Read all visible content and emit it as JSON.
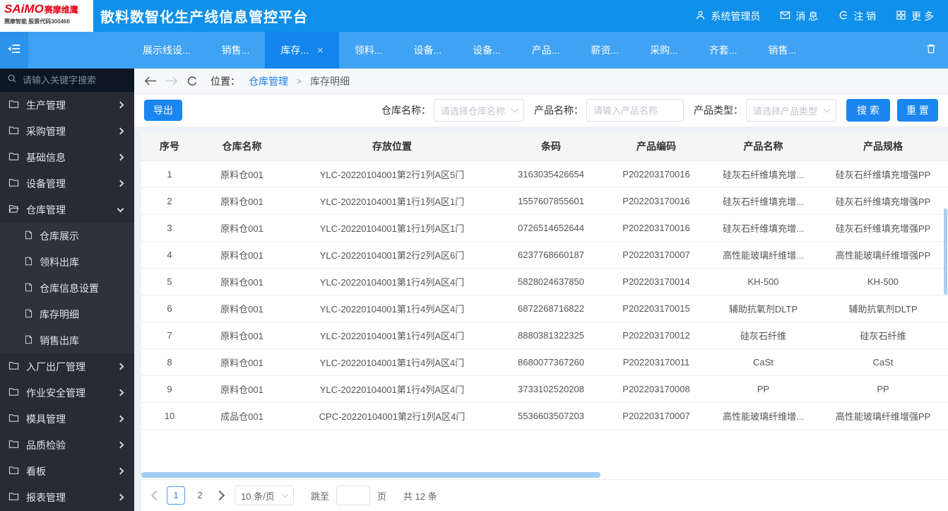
{
  "header": {
    "logo": {
      "brand": "SAiMO",
      "brand_suffix": "赛摩维鹰",
      "subtitle": "赛摩智能 股票代码300466"
    },
    "title": "散料数智化生产线信息管控平台",
    "menu": [
      {
        "key": "user",
        "icon": "user-icon",
        "label": "系统管理员"
      },
      {
        "key": "messages",
        "icon": "mail-icon",
        "label": "消 息"
      },
      {
        "key": "logout",
        "icon": "logout-icon",
        "label": "注 销"
      },
      {
        "key": "more",
        "icon": "grid-icon",
        "label": "更 多"
      }
    ]
  },
  "tabbar": {
    "tabs": [
      {
        "label": "展示线设..."
      },
      {
        "label": "销售..."
      },
      {
        "label": "库存...",
        "active": true
      },
      {
        "label": "领料..."
      },
      {
        "label": "设备..."
      },
      {
        "label": "设备..."
      },
      {
        "label": "产品..."
      },
      {
        "label": "薪资..."
      },
      {
        "label": "采购..."
      },
      {
        "label": "齐套..."
      },
      {
        "label": "销售..."
      }
    ]
  },
  "sidebar": {
    "search_placeholder": "请输入关键字搜索",
    "items": [
      {
        "key": "production",
        "label": "生产管理"
      },
      {
        "key": "purchase",
        "label": "采购管理"
      },
      {
        "key": "basic-info",
        "label": "基础信息"
      },
      {
        "key": "equipment",
        "label": "设备管理"
      },
      {
        "key": "warehouse",
        "label": "仓库管理",
        "expanded": true,
        "children": [
          {
            "key": "warehouse-display",
            "label": "仓库展示"
          },
          {
            "key": "material-outbound",
            "label": "领料出库"
          },
          {
            "key": "warehouse-info-settings",
            "label": "仓库信息设置"
          },
          {
            "key": "inventory-detail",
            "label": "库存明细"
          },
          {
            "key": "sales-outbound",
            "label": "销售出库"
          }
        ]
      },
      {
        "key": "factory-inout",
        "label": "入厂出厂管理"
      },
      {
        "key": "work-safety",
        "label": "作业安全管理"
      },
      {
        "key": "mold",
        "label": "模具管理"
      },
      {
        "key": "quality",
        "label": "品质检验"
      },
      {
        "key": "board",
        "label": "看板"
      },
      {
        "key": "report",
        "label": "报表管理"
      }
    ]
  },
  "breadcrumb": {
    "nav_label": "位置：",
    "parent": "仓库管理",
    "separator": ">",
    "current": "库存明细"
  },
  "toolbar": {
    "export_label": "导出",
    "filters": [
      {
        "key": "warehouse-name",
        "type": "select",
        "label": "仓库名称：",
        "placeholder": "请选择仓库名称"
      },
      {
        "key": "product-name",
        "type": "input",
        "label": "产品名称：",
        "placeholder": "请输入产品名称"
      },
      {
        "key": "product-type",
        "type": "select",
        "label": "产品类型：",
        "placeholder": "请选择产品类型"
      }
    ],
    "search_label": "搜 索",
    "reset_label": "重 置"
  },
  "table": {
    "columns": [
      "序号",
      "仓库名称",
      "存放位置",
      "条码",
      "产品编码",
      "产品名称",
      "产品规格"
    ],
    "rows": [
      [
        "1",
        "原料仓001",
        "YLC-20220104001第2行1列A区5门",
        "3163035426654",
        "P202203170016",
        "硅灰石纤维填充增...",
        "硅灰石纤维填充增强PP"
      ],
      [
        "2",
        "原料仓001",
        "YLC-20220104001第1行1列A区1门",
        "1557607855601",
        "P202203170016",
        "硅灰石纤维填充增...",
        "硅灰石纤维填充增强PP"
      ],
      [
        "3",
        "原料仓001",
        "YLC-20220104001第1行1列A区1门",
        "0726514652644",
        "P202203170016",
        "硅灰石纤维填充增...",
        "硅灰石纤维填充增强PP"
      ],
      [
        "4",
        "原料仓001",
        "YLC-20220104001第2行2列A区6门",
        "6237768660187",
        "P202203170007",
        "高性能玻璃纤维增...",
        "高性能玻璃纤维增强PP"
      ],
      [
        "5",
        "原料仓001",
        "YLC-20220104001第1行4列A区4门",
        "5828024637850",
        "P202203170014",
        "KH-500",
        "KH-500"
      ],
      [
        "6",
        "原料仓001",
        "YLC-20220104001第1行4列A区4门",
        "6872268716822",
        "P202203170015",
        "辅助抗氧剂DLTP",
        "辅助抗氧剂DLTP"
      ],
      [
        "7",
        "原料仓001",
        "YLC-20220104001第1行4列A区4门",
        "8880381322325",
        "P202203170012",
        "硅灰石纤维",
        "硅灰石纤维"
      ],
      [
        "8",
        "原料仓001",
        "YLC-20220104001第1行4列A区4门",
        "8680077367260",
        "P202203170011",
        "CaSt",
        "CaSt"
      ],
      [
        "9",
        "原料仓001",
        "YLC-20220104001第1行4列A区4门",
        "3733102520208",
        "P202203170008",
        "PP",
        "PP"
      ],
      [
        "10",
        "成品仓001",
        "CPC-20220104001第2行1列A区4门",
        "5536603507203",
        "P202203170007",
        "高性能玻璃纤维增...",
        "高性能玻璃纤维增强PP"
      ]
    ]
  },
  "pagination": {
    "pages": [
      "1",
      "2"
    ],
    "active_page": "1",
    "page_size": "10 条/页",
    "jump_label": "跳至",
    "jump_suffix": "页",
    "total": "共 12 条"
  },
  "colors": {
    "header_blue": "#0f90ea",
    "tabbar_blue": "#3fa2f3",
    "active_tab_blue": "#1385ed",
    "primary_button": "#1b86f0",
    "link_blue": "#1a80e8",
    "sidebar_bg": "#262b34",
    "brand_red": "#e60012",
    "scrollbar_blue": "#9fcdf4"
  }
}
